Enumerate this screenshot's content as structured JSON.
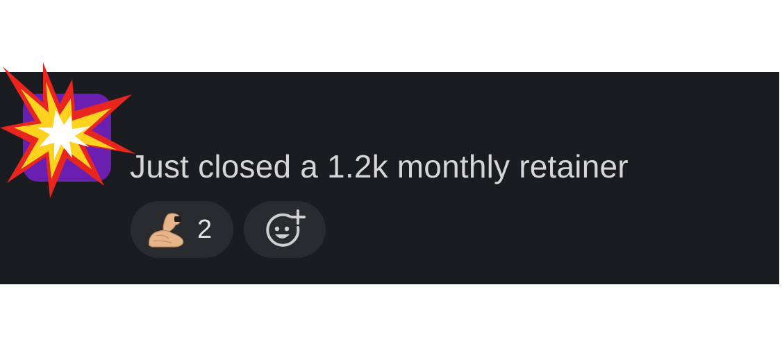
{
  "message": {
    "text": "Just closed a 1.2k monthly retainer",
    "avatar_color": "#6a1fb0",
    "avatar_overlay_icon": "collision-icon"
  },
  "reactions": [
    {
      "emoji": "flexed-biceps-icon",
      "count": "2"
    }
  ],
  "add_reaction": {
    "icon": "add-reaction-icon"
  },
  "colors": {
    "panel_background": "#1b1c1f",
    "pill_background": "#2a2b2f",
    "text": "#d6d6d6"
  }
}
